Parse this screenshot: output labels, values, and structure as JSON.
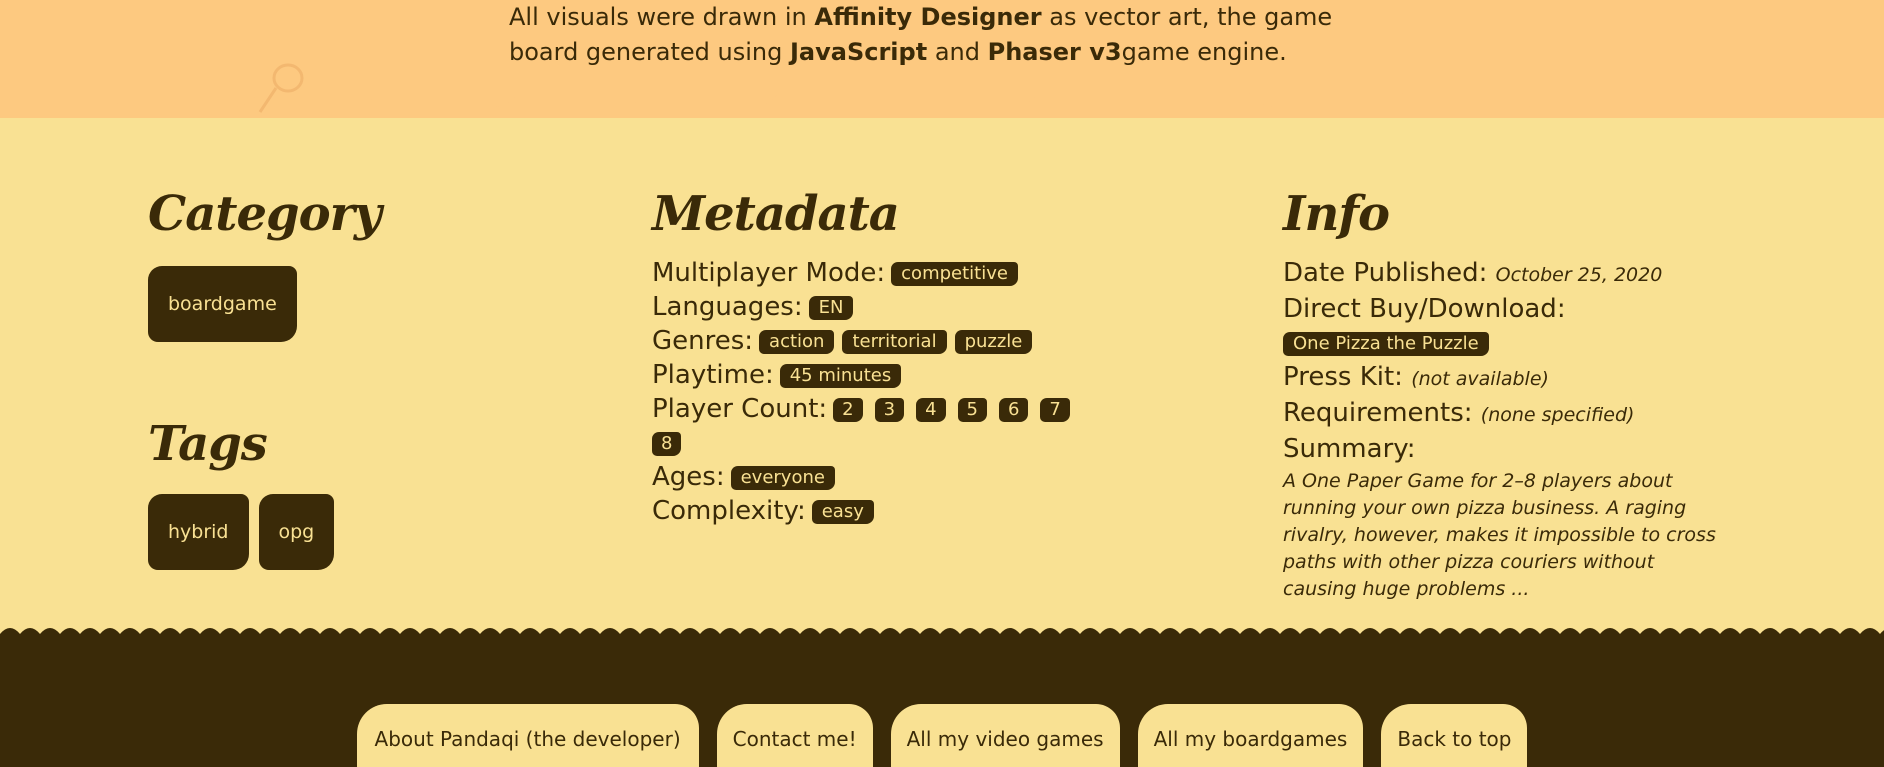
{
  "intro": {
    "part1": "All visuals were drawn in ",
    "bold1": "Affinity Designer",
    "part2": " as vector art, the game board generated using ",
    "bold2": "JavaScript",
    "part3": " and ",
    "bold3": "Phaser v3",
    "part4": "game engine."
  },
  "category": {
    "heading": "Category",
    "items": [
      "boardgame"
    ]
  },
  "tags": {
    "heading": "Tags",
    "items": [
      "hybrid",
      "opg"
    ]
  },
  "metadata": {
    "heading": "Metadata",
    "multiplayer_label": "Multiplayer Mode:",
    "multiplayer_value": "competitive",
    "languages_label": "Languages:",
    "languages": [
      "EN"
    ],
    "genres_label": "Genres:",
    "genres": [
      "action",
      "territorial",
      "puzzle"
    ],
    "playtime_label": "Playtime:",
    "playtime_value": "45 minutes",
    "player_count_label": "Player Count:",
    "player_counts": [
      "2",
      "3",
      "4",
      "5",
      "6",
      "7",
      "8"
    ],
    "ages_label": "Ages:",
    "ages_value": "everyone",
    "complexity_label": "Complexity:",
    "complexity_value": "easy"
  },
  "info": {
    "heading": "Info",
    "date_label": "Date Published:",
    "date_value": "October 25, 2020",
    "download_label": "Direct Buy/Download:",
    "download_link": "One Pizza the Puzzle",
    "presskit_label": "Press Kit:",
    "presskit_value": "(not available)",
    "requirements_label": "Requirements:",
    "requirements_value": "(none specified)",
    "summary_label": "Summary:",
    "summary_text": "A One Paper Game for 2–8 players about running your own pizza business. A raging rivalry, however, makes it impossible to cross paths with other pizza couriers without causing huge problems ..."
  },
  "footer": {
    "links": [
      "About Pandaqi (the developer)",
      "Contact me!",
      "All my video games",
      "All my boardgames",
      "Back to top"
    ]
  },
  "colors": {
    "dark": "#3a2a08",
    "cream": "#f9e193",
    "orange": "#fdc980"
  }
}
